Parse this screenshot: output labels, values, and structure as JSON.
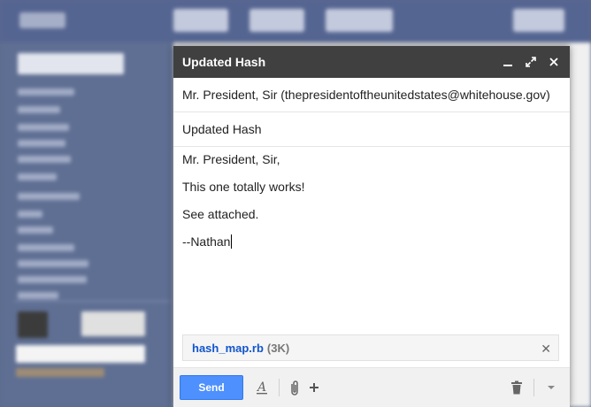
{
  "compose": {
    "title": "Updated Hash",
    "to": "Mr. President, Sir (thepresidentoftheunitedstates@whitehouse.gov)",
    "subject": "Updated Hash",
    "body_lines": [
      "Mr. President, Sir,",
      "This one totally works!",
      "See attached.",
      "--Nathan"
    ],
    "attachment": {
      "name": "hash_map.rb",
      "size": "(3K)"
    },
    "send_label": "Send"
  },
  "icons": {
    "minimize": "minimize-icon",
    "expand": "expand-icon",
    "close": "close-icon",
    "format": "text-format-icon",
    "attach": "paperclip-icon",
    "more": "plus-icon",
    "trash": "trash-icon",
    "options": "dropdown-arrow-icon"
  },
  "colors": {
    "send_button": "#4d90fe",
    "title_bar": "#404040",
    "attachment_link": "#1155cc"
  }
}
